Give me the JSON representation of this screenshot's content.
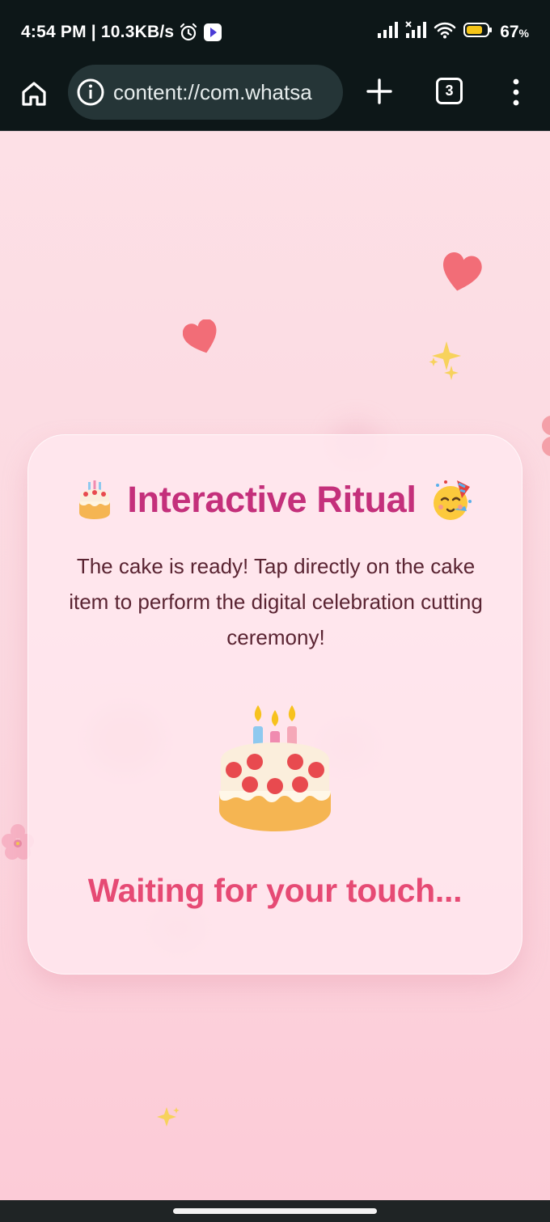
{
  "status_bar": {
    "time_speed": "4:54 PM | 10.3KB/s",
    "battery_percent": "67",
    "battery_unit": "%",
    "icons": [
      "alarm-icon",
      "media-play-icon",
      "signal-icon",
      "signal-no-data-icon",
      "wifi-icon",
      "battery-icon"
    ]
  },
  "browser": {
    "url": "content://com.whatsa",
    "tab_count": "3",
    "icons": [
      "home-icon",
      "info-icon",
      "new-tab-icon",
      "tabs-icon",
      "more-menu-icon"
    ]
  },
  "card": {
    "title": "Interactive Ritual",
    "description": "The cake is ready! Tap directly on the cake item to perform the digital celebration cutting ceremony!",
    "status": "Waiting for your touch..."
  },
  "colors": {
    "title": "#c4307b",
    "status": "#e64a74",
    "description": "#5a2432",
    "background_top": "#fde0e6",
    "background_bottom": "#fccbd7",
    "heart": "#f26d77"
  }
}
